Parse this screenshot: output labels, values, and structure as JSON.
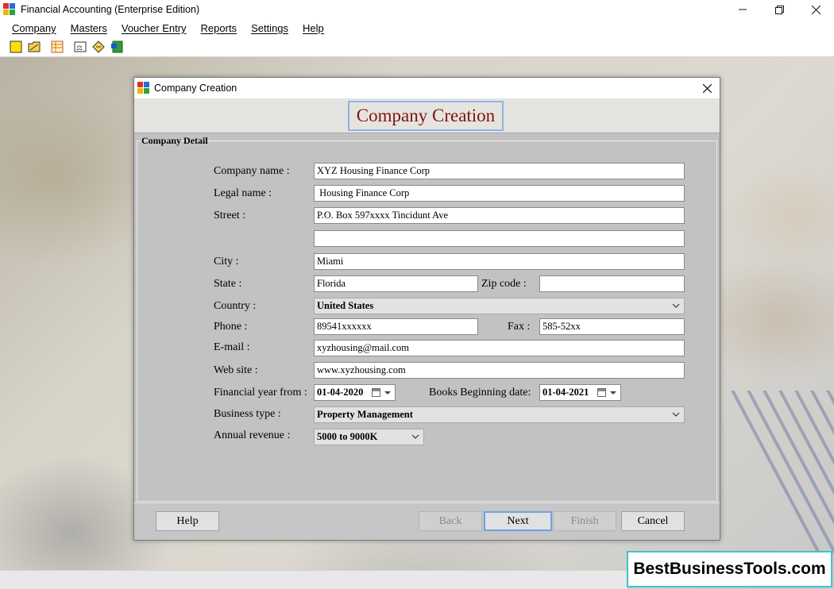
{
  "app": {
    "title": "Financial Accounting (Enterprise Edition)"
  },
  "menu": [
    "Company",
    "Masters",
    "Voucher Entry",
    "Reports",
    "Settings",
    "Help"
  ],
  "dialog": {
    "title": "Company Creation",
    "header": "Company Creation",
    "section": "Company Detail",
    "labels": {
      "company_name": "Company name :",
      "legal_name": "Legal name :",
      "street": "Street :",
      "city": "City :",
      "state": "State :",
      "zip": "Zip code :",
      "country": "Country :",
      "phone": "Phone :",
      "fax": "Fax :",
      "email": "E-mail :",
      "website": "Web site :",
      "fy_from": "Financial year from :",
      "books_begin": "Books Beginning date:",
      "business_type": "Business type :",
      "annual_revenue": "Annual revenue :"
    },
    "values": {
      "company_name": "XYZ Housing Finance Corp",
      "legal_name": " Housing Finance Corp",
      "street1": "P.O. Box 597xxxx Tincidunt Ave",
      "street2": "",
      "city": "Miami",
      "state": "Florida",
      "zip": "",
      "country": "United States",
      "phone": "89541xxxxxx",
      "fax": "585-52xx",
      "email": "xyzhousing@mail.com",
      "website": "www.xyzhousing.com",
      "fy_from": "01-04-2020",
      "books_begin": "01-04-2021",
      "business_type": "Property Management",
      "annual_revenue": "5000 to 9000K"
    },
    "buttons": {
      "help": "Help",
      "back": "Back",
      "next": "Next",
      "finish": "Finish",
      "cancel": "Cancel"
    }
  },
  "watermark": "BestBusinessTools.com",
  "colors": {
    "header_title": "#7a1414",
    "focus_border": "#6ea1e8",
    "watermark_border": "#3ec4cf"
  }
}
